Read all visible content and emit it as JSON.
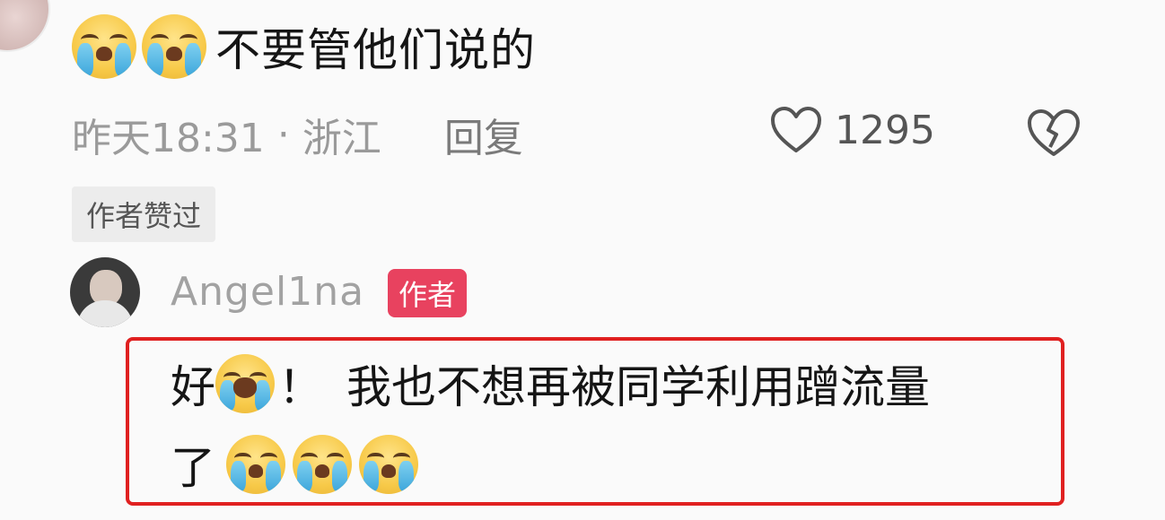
{
  "comment": {
    "text": "不要管他们说的",
    "emojis": [
      "crying-face",
      "crying-face"
    ],
    "time": "昨天18:31",
    "separator": "·",
    "location": "浙江",
    "reply_label": "回复",
    "like_count": "1295",
    "liked_badge": "作者赞过"
  },
  "reply": {
    "username": "Angel1na",
    "author_badge": "作者",
    "line1_prefix": "好",
    "line1_punct": "！",
    "line1_text": "我也不想再被同学利用蹭流量",
    "line2_text": "了",
    "emojis_line1": [
      "wailing-face"
    ],
    "emojis_line2": [
      "crying-face",
      "crying-face",
      "crying-face"
    ]
  },
  "colors": {
    "highlight": "#e02020",
    "author_badge_bg": "#e8425f"
  }
}
